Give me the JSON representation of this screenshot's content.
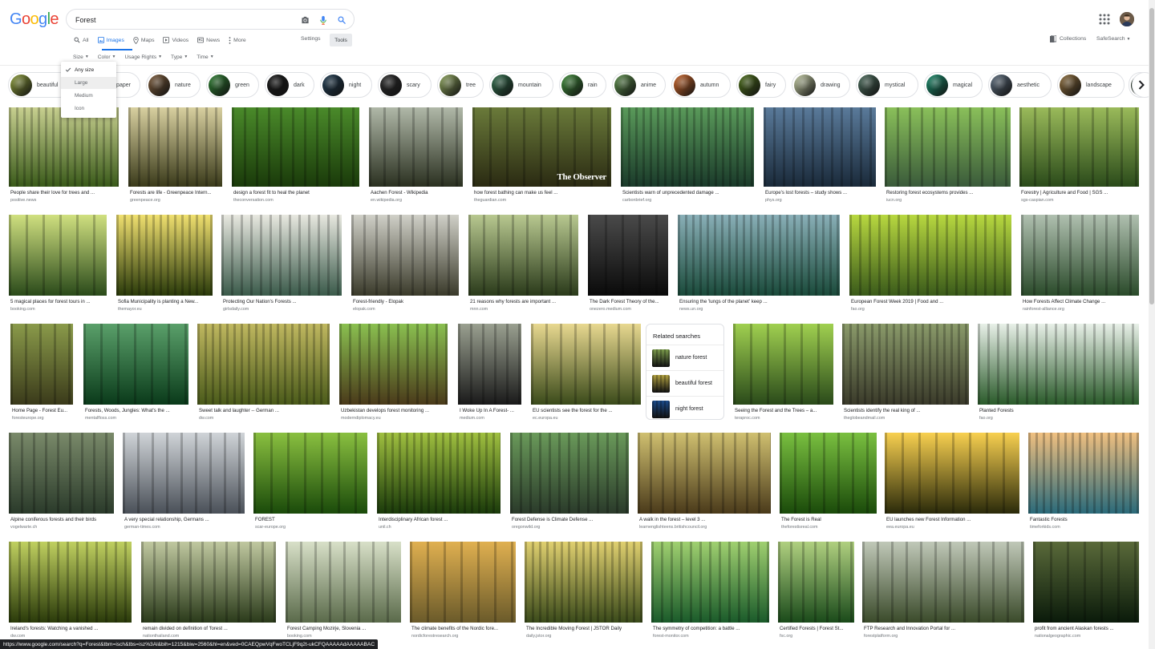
{
  "logo": {
    "text": "Google",
    "colors": [
      "#4285F4",
      "#EA4335",
      "#FBBC05",
      "#4285F4",
      "#34A853",
      "#EA4335"
    ]
  },
  "search": {
    "value": "Forest",
    "placeholder": ""
  },
  "tabs": [
    {
      "label": "All",
      "icon": "search-icon",
      "active": false
    },
    {
      "label": "Images",
      "icon": "image-icon",
      "active": true
    },
    {
      "label": "Maps",
      "icon": "map-pin-icon",
      "active": false
    },
    {
      "label": "Videos",
      "icon": "video-icon",
      "active": false
    },
    {
      "label": "News",
      "icon": "news-icon",
      "active": false
    },
    {
      "label": "More",
      "icon": "more-dots-icon",
      "active": false
    }
  ],
  "settings_label": "Settings",
  "tools_label": "Tools",
  "collections_label": "Collections",
  "safesearch_label": "SafeSearch",
  "tool_filters": [
    "Size",
    "Color",
    "Usage Rights",
    "Type",
    "Time"
  ],
  "size_menu": {
    "options": [
      "Any size",
      "Large",
      "Medium",
      "Icon"
    ],
    "selected": "Any size",
    "hovered": "Large"
  },
  "chips": [
    {
      "label": "beautiful",
      "color": "#8a9a3a"
    },
    {
      "label": "wallpaper",
      "color": "#3a6a3a"
    },
    {
      "label": "nature",
      "color": "#7a5a3a"
    },
    {
      "label": "green",
      "color": "#2e7d32"
    },
    {
      "label": "dark",
      "color": "#1a1a1a"
    },
    {
      "label": "night",
      "color": "#1f3a4f"
    },
    {
      "label": "scary",
      "color": "#2a2a2a"
    },
    {
      "label": "tree",
      "color": "#8aa05a"
    },
    {
      "label": "mountain",
      "color": "#2f6a4a"
    },
    {
      "label": "rain",
      "color": "#3f8a3a"
    },
    {
      "label": "anime",
      "color": "#5a8a4a"
    },
    {
      "label": "autumn",
      "color": "#c8642a"
    },
    {
      "label": "fairy",
      "color": "#4a6a1a"
    },
    {
      "label": "drawing",
      "color": "#c0c8a0"
    },
    {
      "label": "mystical",
      "color": "#4a6a5a"
    },
    {
      "label": "magical",
      "color": "#1a8a6a"
    },
    {
      "label": "aesthetic",
      "color": "#5a6a7a"
    },
    {
      "label": "landscape",
      "color": "#8a6a3a"
    },
    {
      "label": "",
      "color": "#2a3a2a"
    }
  ],
  "images": [
    {
      "caption": "People share their love for trees and ...",
      "source": "positive.news",
      "c1": "#c8d090",
      "c2": "#3a5a1a"
    },
    {
      "caption": "Forests are life - Greenpeace Intern...",
      "source": "greenpeace.org",
      "c1": "#d8d0a0",
      "c2": "#3a3a1a"
    },
    {
      "caption": "design a forest fit to heal the planet",
      "source": "theconversation.com",
      "c1": "#4a8a2a",
      "c2": "#1a3a0a"
    },
    {
      "caption": "Aachen Forest - Wikipedia",
      "source": "en.wikipedia.org",
      "c1": "#b0b8a8",
      "c2": "#2a3020"
    },
    {
      "caption": "how forest bathing can make us feel ...",
      "source": "theguardian.com",
      "c1": "#6a7a3a",
      "c2": "#2a2a12"
    },
    {
      "caption": "Scientists warn of unprecedented damage ...",
      "source": "carbonbrief.org",
      "c1": "#5a9a5a",
      "c2": "#1a3a2a"
    },
    {
      "caption": "Europe's lost forests – study shows ...",
      "source": "phys.org",
      "c1": "#5a7a9a",
      "c2": "#1a2a3a"
    },
    {
      "caption": "Restoring forest ecosystems provides ...",
      "source": "iucn.org",
      "c1": "#8ac05a",
      "c2": "#3a5a3a"
    },
    {
      "caption": "Forestry | Agriculture and Food | SGS ...",
      "source": "sgs-caspian.com",
      "c1": "#9aba5a",
      "c2": "#2a4a1a"
    },
    {
      "caption": "5 magical places for forest tours in ...",
      "source": "booking.com",
      "c1": "#d0e080",
      "c2": "#2a4a1a"
    },
    {
      "caption": "Sofia Municipality is planting a New...",
      "source": "themayor.eu",
      "c1": "#f0e070",
      "c2": "#2a3a0a"
    },
    {
      "caption": "Protecting Our Nation's Forests ...",
      "source": "girlsdaily.com",
      "c1": "#e8e8e0",
      "c2": "#3a5a4a"
    },
    {
      "caption": "Forest-friendly - Elopak",
      "source": "elopak.com",
      "c1": "#d0d0c8",
      "c2": "#3a3a2a"
    },
    {
      "caption": "21 reasons why forests are important ...",
      "source": "mnn.com",
      "c1": "#b8c890",
      "c2": "#2a3a1a"
    },
    {
      "caption": "The Dark Forest Theory of the...",
      "source": "onezero.medium.com",
      "c1": "#4a4a4a",
      "c2": "#0a0a0a"
    },
    {
      "caption": "Ensuring the 'lungs of the planet' keep ...",
      "source": "news.un.org",
      "c1": "#8ab0b8",
      "c2": "#1a4a3a"
    },
    {
      "caption": "European Forest Week 2019 | Food and ...",
      "source": "fao.org",
      "c1": "#b8d840",
      "c2": "#3a5a1a"
    },
    {
      "caption": "How Forests Affect Climate Change ...",
      "source": "rainforest-alliance.org",
      "c1": "#b0c0b0",
      "c2": "#2a4a2a"
    },
    {
      "caption": "Home Page - Forest Eu...",
      "source": "foresteurope.org",
      "c1": "#8a9a4a",
      "c2": "#3a3a1a"
    },
    {
      "caption": "Forests, Woods, Jungles: What's the ...",
      "source": "mentalfloss.com",
      "c1": "#5aa06a",
      "c2": "#0a3a1a"
    },
    {
      "caption": "Sweet talk and laughter -- German ...",
      "source": "dw.com",
      "c1": "#c0b860",
      "c2": "#4a5a1a"
    },
    {
      "caption": "Uzbekistan develops forest monitoring ...",
      "source": "moderndiplomacy.eu",
      "c1": "#8ac050",
      "c2": "#4a3a1a"
    },
    {
      "caption": "I Woke Up In A Forest- ...",
      "source": "medium.com",
      "c1": "#9aa090",
      "c2": "#1a1a1a"
    },
    {
      "caption": "EU scientists see the forest for the ...",
      "source": "ec.europa.eu",
      "c1": "#e8d890",
      "c2": "#3a4a1a"
    },
    {
      "caption": "Seeing the Forest and the Trees – a...",
      "source": "teraproc.com",
      "c1": "#a0d050",
      "c2": "#2a4a1a"
    },
    {
      "caption": "Scientists identify the real king of ...",
      "source": "theglobeandmail.com",
      "c1": "#8a9a6a",
      "c2": "#3a3a2a"
    },
    {
      "caption": "Planted Forests",
      "source": "fao.org",
      "c1": "#e8f0e8",
      "c2": "#2a5a2a"
    },
    {
      "caption": "Alpine coniferous forests and their birds",
      "source": "vogelwarte.ch",
      "c1": "#7a8a6a",
      "c2": "#2a3a2a"
    },
    {
      "caption": "A very special relationship, Germans ...",
      "source": "german-times.com",
      "c1": "#d0d4d8",
      "c2": "#4a5058"
    },
    {
      "caption": "FOREST",
      "source": "scar-europe.org",
      "c1": "#8ac040",
      "c2": "#1a4a0a"
    },
    {
      "caption": "Interdisciplinary African forest ...",
      "source": "unil.ch",
      "c1": "#a0c040",
      "c2": "#1a3a0a"
    },
    {
      "caption": "Forest Defense is Climate Defense ...",
      "source": "oregonwild.org",
      "c1": "#6a9a5a",
      "c2": "#2a3a2a"
    },
    {
      "caption": "A walk in the forest – level 3 ...",
      "source": "learnenglishteens.britishcouncil.org",
      "c1": "#d0c070",
      "c2": "#4a3a1a"
    },
    {
      "caption": "The Forest is Real",
      "source": "theforestisreal.com",
      "c1": "#7ac040",
      "c2": "#1a4a0a"
    },
    {
      "caption": "EU launches new Forest Information ...",
      "source": "eea.europa.eu",
      "c1": "#f8d050",
      "c2": "#2a2a0a"
    },
    {
      "caption": "Fantastic Forests",
      "source": "timeforkids.com",
      "c1": "#f0c080",
      "c2": "#2a6a7a"
    },
    {
      "caption": "Ireland's forests: Watching a vanished ...",
      "source": "dw.com",
      "c1": "#c0d060",
      "c2": "#2a3a0a"
    },
    {
      "caption": "remain divided on definition of 'forest ...",
      "source": "nationthailand.com",
      "c1": "#c0c8a0",
      "c2": "#2a3a1a"
    },
    {
      "caption": "Forest Camping Mozirje, Slovenia ...",
      "source": "booking.com",
      "c1": "#d8e0c8",
      "c2": "#5a6a4a"
    },
    {
      "caption": "The climate benefits of the Nordic fore...",
      "source": "nordicforestresearch.org",
      "c1": "#e0b050",
      "c2": "#6a5a2a"
    },
    {
      "caption": "The Incredible Moving Forest | JSTOR Daily",
      "source": "daily.jstor.org",
      "c1": "#e0d070",
      "c2": "#3a4a1a"
    },
    {
      "caption": "The symmetry of competition: a battle ...",
      "source": "forest-monitor.com",
      "c1": "#a0d070",
      "c2": "#1a5a2a"
    },
    {
      "caption": "Certified Forests | Forest St...",
      "source": "fsc.org",
      "c1": "#b0d080",
      "c2": "#1a4a1a"
    },
    {
      "caption": "FTP Research and Innovation Portal for ...",
      "source": "forestplatform.org",
      "c1": "#c0c8b8",
      "c2": "#3a4a2a"
    },
    {
      "caption": "profit from ancient Alaskan forests ...",
      "source": "nationalgeographic.com",
      "c1": "#5a6a3a",
      "c2": "#0a1a0a"
    }
  ],
  "observer_label": "The Observer",
  "related": {
    "title": "Related searches",
    "items": [
      {
        "label": "nature forest",
        "color": "#7a9a4a"
      },
      {
        "label": "beautiful forest",
        "color": "#b0a040"
      },
      {
        "label": "night forest",
        "color": "#1a4a8a"
      }
    ]
  },
  "status_url": "https://www.google.com/search?q=Forest&tbm=isch&tbs=isz%3Al&bih=1215&biw=2560&hl=en&ved=0CAEQpwVqFwoTCLjF9q2t-ukCFQAAAAAdAAAAABAC"
}
